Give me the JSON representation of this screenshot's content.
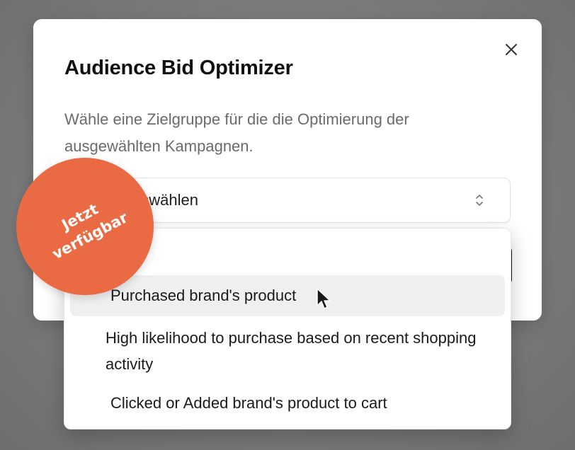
{
  "modal": {
    "title": "Audience Bid Optimizer",
    "description": "Wähle eine Zielgruppe für die die Optimierung der ausgewählten Kampagnen.",
    "close_icon": "close-icon"
  },
  "select": {
    "visible_text": "ppe auswählen",
    "caret_icon": "chevron-up-down-icon"
  },
  "dropdown": {
    "options": [
      {
        "label": "Purchased brand's product",
        "highlighted": true
      },
      {
        "label": "High likelihood to purchase based on recent shopping activity",
        "highlighted": false
      },
      {
        "label": "Clicked or Added brand's product to cart",
        "highlighted": false
      }
    ]
  },
  "badge": {
    "line1": "Jetzt",
    "line2": "verfügbar",
    "color": "#ea6a43"
  },
  "cursor_icon": "mouse-pointer-icon"
}
